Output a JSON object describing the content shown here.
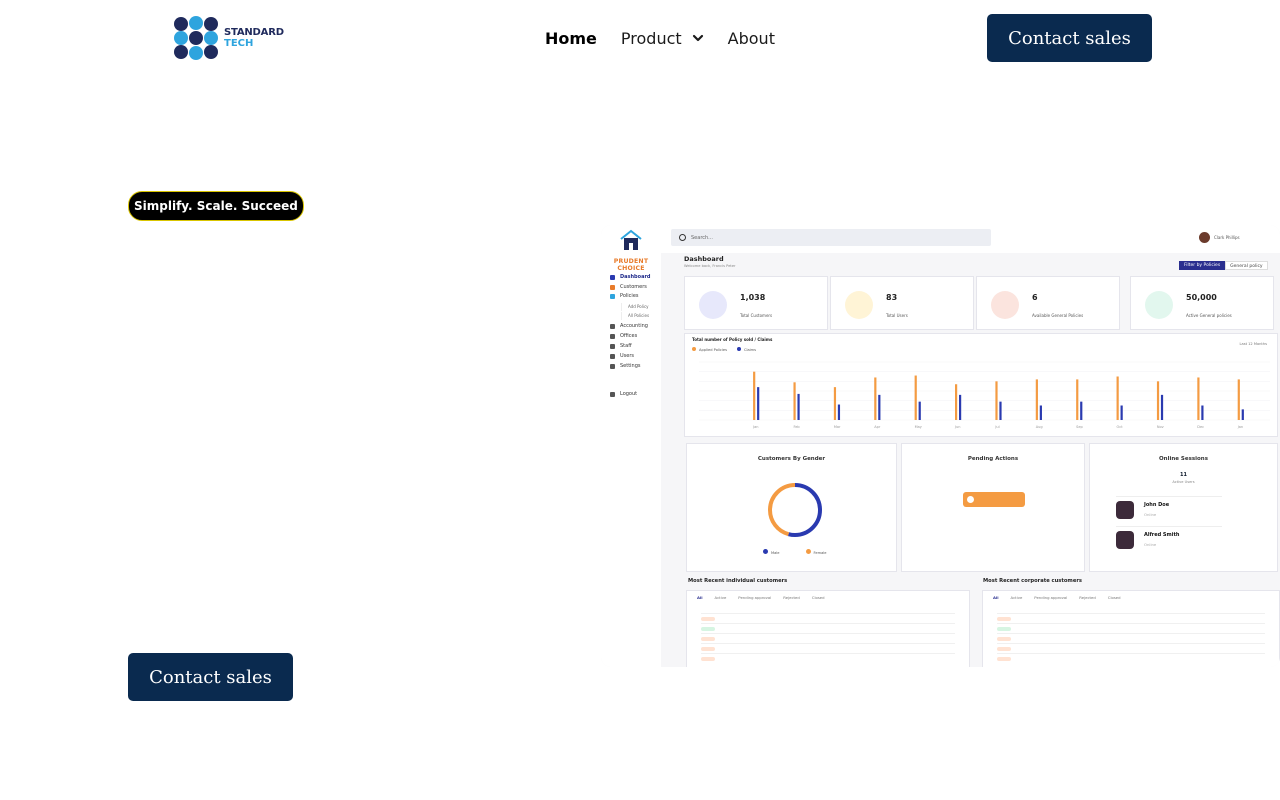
{
  "nav": {
    "logo": {
      "line1": "STANDARD",
      "line2": "TECH"
    },
    "links": [
      {
        "label": "Home",
        "active": true
      },
      {
        "label": "Product",
        "has_dropdown": true
      },
      {
        "label": "About"
      }
    ],
    "cta": "Contact sales"
  },
  "hero": {
    "tagline": "Simplify. Scale. Succeed",
    "cta": "Contact sales"
  },
  "dashboard": {
    "brand": "PRUDENT CHOICE",
    "search_placeholder": "Search...",
    "user_name": "Clark Phillips",
    "title": "Dashboard",
    "subtitle": "Welcome back, Francis Peter",
    "filter": {
      "active": "Filter by Policies",
      "select": "General policy"
    },
    "sidebar": [
      {
        "label": "Dashboard",
        "active": true
      },
      {
        "label": "Customers"
      },
      {
        "label": "Policies"
      },
      {
        "label": "Accounting"
      },
      {
        "label": "Offices"
      },
      {
        "label": "Staff"
      },
      {
        "label": "Users"
      },
      {
        "label": "Settings"
      },
      {
        "label": "Logout"
      }
    ],
    "policy_sub": [
      "Add Policy",
      "All Policies"
    ],
    "stats": [
      {
        "value": "1,038",
        "label": "Total Customers",
        "color": "#e7e8fb",
        "icon": "customers-icon"
      },
      {
        "value": "83",
        "label": "Total Users",
        "color": "#fff4d6",
        "icon": "users-icon"
      },
      {
        "value": "6",
        "label": "Available General Policies",
        "color": "#fbe4de",
        "icon": "policies-icon"
      },
      {
        "value": "50,000",
        "label": "Active General policies",
        "color": "#e2f7ee",
        "icon": "naira-icon"
      }
    ],
    "chart": {
      "title": "Total number of Policy sold / Claims",
      "period": "Last 12 Months",
      "legend": [
        "Applied Policies",
        "Claims"
      ]
    },
    "gender": {
      "title": "Customers By Gender",
      "legend": [
        "Male",
        "Female"
      ]
    },
    "pending": {
      "title": "Pending Actions"
    },
    "sessions": {
      "title": "Online Sessions",
      "count": "11",
      "count_label": "Active Users",
      "users": [
        {
          "name": "John Doe",
          "status": "Online"
        },
        {
          "name": "Alfred Smith",
          "status": "Online"
        }
      ]
    },
    "tables": [
      {
        "title": "Most Recent individual customers",
        "tabs": [
          "All",
          "Active",
          "Pending approval",
          "Rejected",
          "Closed"
        ]
      },
      {
        "title": "Most Recent corporate customers",
        "tabs": [
          "All",
          "Active",
          "Pending approval",
          "Rejected",
          "Closed"
        ]
      }
    ]
  },
  "colors": {
    "navy": "#0a2a4f",
    "orange": "#f49b42",
    "indigo": "#2a3ab0"
  },
  "chart_data": {
    "type": "bar",
    "series": [
      {
        "name": "Applied Policies",
        "values": [
          50,
          39,
          34,
          44,
          46,
          37,
          40,
          42,
          42,
          45,
          40,
          44,
          42
        ]
      },
      {
        "name": "Claims",
        "values": [
          34,
          27,
          16,
          26,
          19,
          26,
          19,
          15,
          19,
          15,
          26,
          15,
          11
        ]
      }
    ],
    "categories": [
      "Jan",
      "Feb",
      "Mar",
      "Apr",
      "May",
      "Jun",
      "Jul",
      "Aug",
      "Sep",
      "Oct",
      "Nov",
      "Dec",
      "Jan"
    ],
    "ylim": [
      0,
      60
    ]
  }
}
